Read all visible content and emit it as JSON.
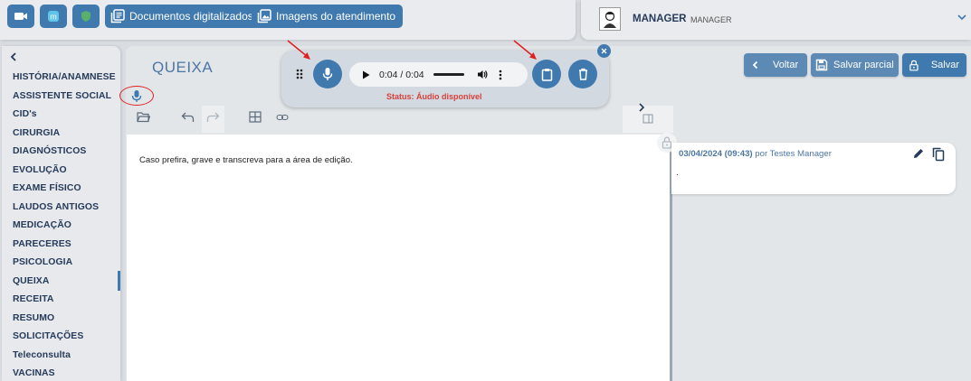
{
  "topbar": {
    "buttons": [
      {
        "icon": "video-camera-icon"
      },
      {
        "icon": "m-logo-icon"
      },
      {
        "icon": "shield-icon"
      }
    ],
    "documentos_label": "Documentos digitalizados",
    "imagens_label": "Imagens do atendimento"
  },
  "user": {
    "name": "MANAGER",
    "role": "MANAGER"
  },
  "sidebar": {
    "items": [
      "HISTÓRIA/ANAMNESE",
      "ASSISTENTE SOCIAL",
      "CID's",
      "CIRURGIA",
      "DIAGNÓSTICOS",
      "EVOLUÇÃO",
      "EXAME FÍSICO",
      "LAUDOS ANTIGOS",
      "MEDICAÇÃO",
      "PARECERES",
      "PSICOLOGIA",
      "QUEIXA",
      "RECEITA",
      "RESUMO",
      "SOLICITAÇÕES",
      "Teleconsulta",
      "VACINAS"
    ],
    "active": "QUEIXA"
  },
  "main": {
    "title": "QUEIXA",
    "editor_text": "Caso prefira, grave e transcreva para a área de edição."
  },
  "actions": {
    "voltar": "Voltar",
    "salvar_parcial": "Salvar parcial",
    "salvar": "Salvar"
  },
  "history": {
    "date": "03/04/2024 (09:43)",
    "by": "por Testes Manager",
    "text": "."
  },
  "audio": {
    "time": "0:04 / 0:04",
    "status": "Status: Áudio disponível"
  },
  "colors": {
    "primary": "#3f79ad",
    "status": "#d9403a",
    "annotation": "#e02020"
  }
}
